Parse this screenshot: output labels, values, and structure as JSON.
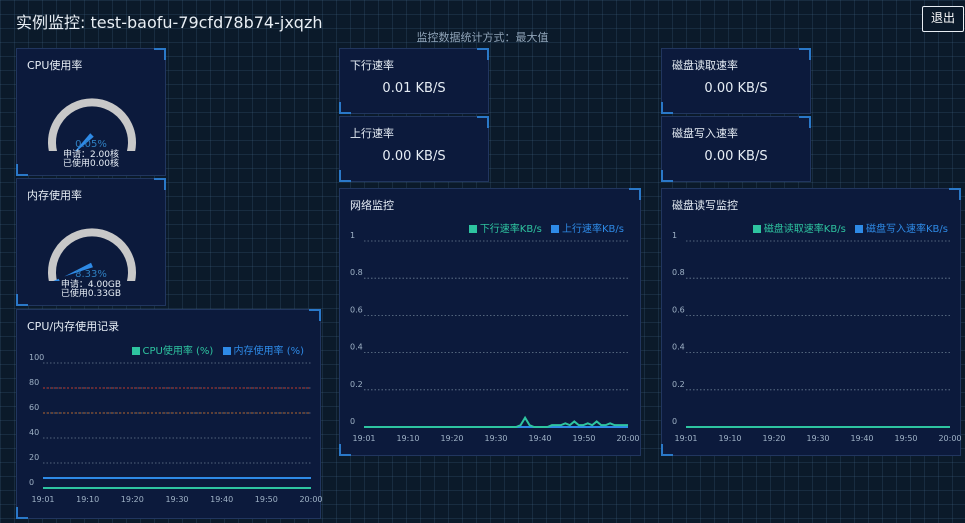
{
  "header": {
    "title": "实例监控: test-baofu-79cfd78b74-jxqzh",
    "subtitle": "监控数据统计方式：最大值",
    "logout_label": "退出"
  },
  "gauges": {
    "cpu": {
      "title": "CPU使用率",
      "percent": "0.05%",
      "value": 0.05,
      "line1": "申请：2.00核",
      "line2": "已使用0.00核"
    },
    "mem": {
      "title": "内存使用率",
      "percent": "8.33%",
      "value": 8.33,
      "line1": "申请：4.00GB",
      "line2": "已使用0.33GB"
    }
  },
  "stats": {
    "down": {
      "title": "下行速率",
      "value": "0.01 KB/S"
    },
    "up": {
      "title": "上行速率",
      "value": "0.00 KB/S"
    },
    "disk_read": {
      "title": "磁盘读取速率",
      "value": "0.00 KB/S"
    },
    "disk_write": {
      "title": "磁盘写入速率",
      "value": "0.00 KB/S"
    }
  },
  "colors": {
    "green": "#2ec4a0",
    "blue": "#2e8ae6"
  },
  "chart_data": [
    {
      "id": "cpu_mem",
      "type": "line",
      "title": "CPU/内存使用记录",
      "x_ticks": [
        "19:01",
        "19:10",
        "19:20",
        "19:30",
        "19:40",
        "19:50",
        "20:00"
      ],
      "y_ticks": [
        "0",
        "20",
        "40",
        "60",
        "80",
        "100"
      ],
      "ylim": [
        0,
        100
      ],
      "series": [
        {
          "name": "CPU使用率 (%)",
          "color": "#2ec4a0",
          "values": [
            0,
            0,
            0,
            0,
            0,
            0,
            0
          ]
        },
        {
          "name": "内存使用率 (%)",
          "color": "#2e8ae6",
          "values": [
            8,
            8,
            8,
            8,
            8,
            8,
            8
          ]
        }
      ],
      "thresholds": [
        {
          "value": 60,
          "color": "#b5662e"
        },
        {
          "value": 80,
          "color": "#c0392b"
        }
      ],
      "grid": true,
      "legend": "top-right"
    },
    {
      "id": "network",
      "type": "line",
      "title": "网络监控",
      "x_ticks": [
        "19:01",
        "19:10",
        "19:20",
        "19:30",
        "19:40",
        "19:50",
        "20:00"
      ],
      "y_ticks": [
        "0",
        "0.2",
        "0.4",
        "0.6",
        "0.8",
        "1"
      ],
      "ylim": [
        0,
        1
      ],
      "series": [
        {
          "name": "下行速率KB/s",
          "color": "#2ec4a0",
          "values": [
            0,
            0,
            0,
            0,
            0,
            0,
            0,
            0,
            0,
            0,
            0,
            0,
            0,
            0,
            0,
            0,
            0,
            0,
            0,
            0,
            0,
            0,
            0,
            0,
            0,
            0,
            0,
            0,
            0,
            0,
            0,
            0,
            0,
            0,
            0,
            0.01,
            0.05,
            0.01,
            0,
            0,
            0,
            0,
            0.01,
            0.01,
            0.01,
            0.02,
            0.01,
            0.03,
            0.01,
            0.01,
            0.02,
            0.01,
            0.03,
            0.01,
            0.01,
            0.02,
            0.01,
            0.01,
            0.01,
            0.01
          ]
        },
        {
          "name": "上行速率KB/s",
          "color": "#2e8ae6",
          "values": [
            0,
            0,
            0,
            0,
            0,
            0,
            0,
            0,
            0,
            0,
            0,
            0,
            0,
            0,
            0,
            0,
            0,
            0,
            0,
            0,
            0,
            0,
            0,
            0,
            0,
            0,
            0,
            0,
            0,
            0,
            0,
            0,
            0,
            0,
            0,
            0,
            0,
            0,
            0,
            0,
            0,
            0,
            0,
            0,
            0,
            0,
            0,
            0,
            0,
            0,
            0,
            0,
            0,
            0,
            0,
            0,
            0,
            0,
            0,
            0
          ]
        }
      ],
      "grid": true,
      "legend": "top-right"
    },
    {
      "id": "disk",
      "type": "line",
      "title": "磁盘读写监控",
      "x_ticks": [
        "19:01",
        "19:10",
        "19:20",
        "19:30",
        "19:40",
        "19:50",
        "20:00"
      ],
      "y_ticks": [
        "0",
        "0.2",
        "0.4",
        "0.6",
        "0.8",
        "1"
      ],
      "ylim": [
        0,
        1
      ],
      "series": [
        {
          "name": "磁盘读取速率KB/s",
          "color": "#2ec4a0",
          "values": [
            0,
            0,
            0,
            0,
            0,
            0,
            0
          ]
        },
        {
          "name": "磁盘写入速率KB/s",
          "color": "#2e8ae6",
          "values": [
            0,
            0,
            0,
            0,
            0,
            0,
            0
          ]
        }
      ],
      "grid": true,
      "legend": "top-right"
    }
  ]
}
